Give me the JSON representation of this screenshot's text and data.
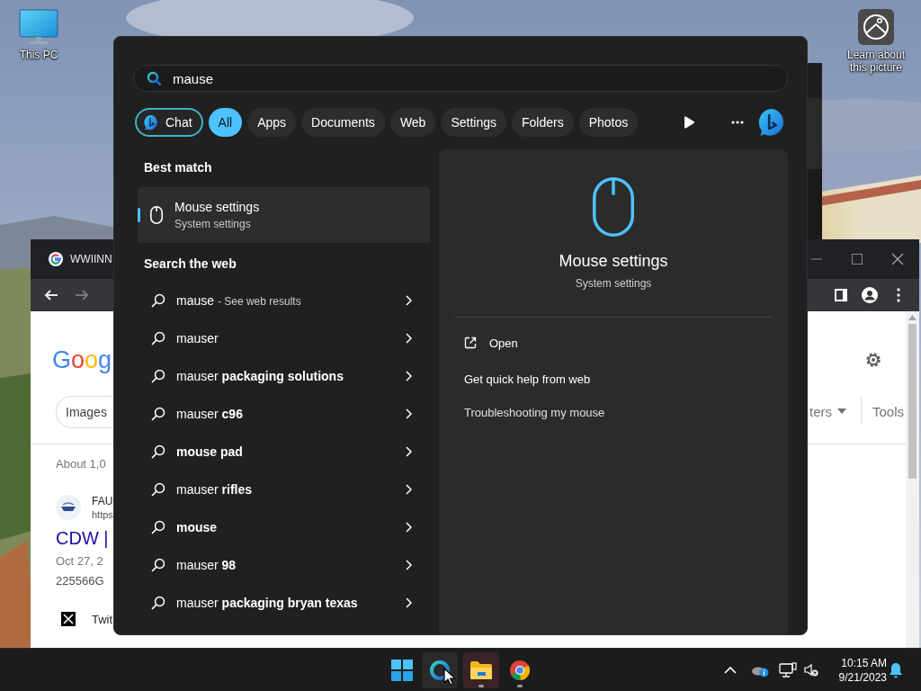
{
  "desktop_icons": [
    {
      "label": "This PC",
      "kind": "computer"
    },
    {
      "label": "Learn about this picture",
      "kind": "picture_info"
    }
  ],
  "browser": {
    "tab_title": "WWIINN",
    "logo_text": "Goog",
    "chip": "Images",
    "result_count": "About 1,0",
    "site_name": "FAU",
    "site_url": "https",
    "result_title": "CDW |",
    "result_date": "Oct 27, 2",
    "result_snippet": "225566G",
    "second_site_name": "Twit",
    "filters_partial": "ters",
    "tools": "Tools"
  },
  "search": {
    "query": "mause"
  },
  "filters": [
    {
      "label": "Chat",
      "kind": "chat",
      "selected": false
    },
    {
      "label": "All",
      "kind": "scope",
      "selected": true
    },
    {
      "label": "Apps",
      "kind": "scope",
      "selected": false
    },
    {
      "label": "Documents",
      "kind": "scope",
      "selected": false
    },
    {
      "label": "Web",
      "kind": "scope",
      "selected": false
    },
    {
      "label": "Settings",
      "kind": "scope",
      "selected": false
    },
    {
      "label": "Folders",
      "kind": "scope",
      "selected": false
    },
    {
      "label": "Photos",
      "kind": "scope",
      "selected": false
    }
  ],
  "best_match": {
    "heading": "Best match",
    "title": "Mouse settings",
    "subtitle": "System settings",
    "selected": true
  },
  "web_section": {
    "heading": "Search the web",
    "results": [
      {
        "text": "mause",
        "suffix": "- See web results"
      },
      {
        "text": "mauser"
      },
      {
        "text": "mauser **packaging solutions**"
      },
      {
        "text": "mauser **c96**"
      },
      {
        "text": "**mouse pad**"
      },
      {
        "text": "mauser **rifles**"
      },
      {
        "text": "**mouse**"
      },
      {
        "text": "mauser **98**"
      },
      {
        "text": "mauser **packaging bryan texas**"
      }
    ]
  },
  "preview": {
    "title": "Mouse settings",
    "subtitle": "System settings",
    "actions": [
      {
        "label": "Open",
        "kind": "open"
      }
    ],
    "help_heading": "Get quick help from web",
    "links": [
      "Troubleshooting my mouse"
    ]
  },
  "taskbar": {
    "apps": [
      {
        "kind": "start",
        "running": false,
        "highlighted": false
      },
      {
        "kind": "search",
        "running": false,
        "highlighted": true
      },
      {
        "kind": "explorer",
        "running": true,
        "highlighted": true
      },
      {
        "kind": "chrome",
        "running": true,
        "highlighted": false
      }
    ],
    "time": "10:15 AM",
    "date": "9/21/2023"
  }
}
